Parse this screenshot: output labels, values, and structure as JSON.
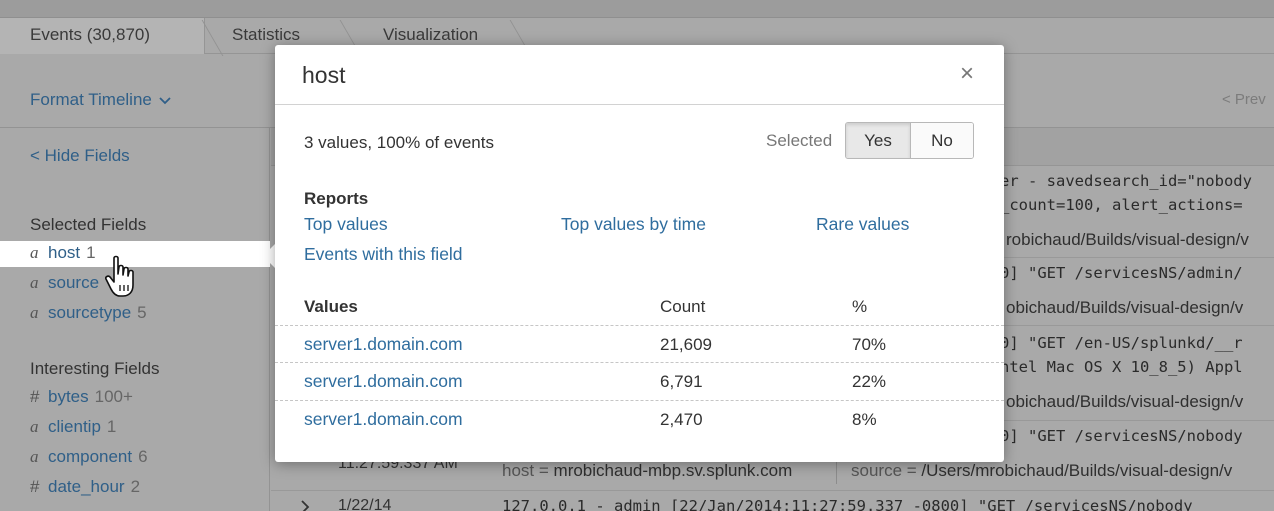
{
  "tabs": [
    {
      "label": "Events (30,870)",
      "active": true
    },
    {
      "label": "Statistics",
      "active": false
    },
    {
      "label": "Visualization",
      "active": false
    }
  ],
  "toolbar": {
    "format_timeline": "Format Timeline",
    "prev": "< Prev"
  },
  "sidebar": {
    "hide_fields": "< Hide Fields",
    "selected_title": "Selected Fields",
    "selected": [
      {
        "type": "a",
        "name": "host",
        "count": "1"
      },
      {
        "type": "a",
        "name": "source",
        "count": ""
      },
      {
        "type": "a",
        "name": "sourcetype",
        "count": "5"
      }
    ],
    "interesting_title": "Interesting Fields",
    "interesting": [
      {
        "type": "#",
        "name": "bytes",
        "count": "100+"
      },
      {
        "type": "a",
        "name": "clientip",
        "count": "1"
      },
      {
        "type": "a",
        "name": "component",
        "count": "6"
      },
      {
        "type": "#",
        "name": "date_hour",
        "count": "2"
      }
    ]
  },
  "events": {
    "lines": [
      "er - savedsearch_id=\"nobody",
      "_count=100, alert_actions=",
      "robichaud/Builds/visual-design/v",
      "0] \"GET /servicesNS/admin/",
      "obichaud/Builds/visual-design/v",
      "0] \"GET /en-US/splunkd/__r",
      "ntel Mac OS X 10_8_5) Appl",
      "obichaud/Builds/visual-design/v",
      "0] \"GET /servicesNS/nobody"
    ],
    "time_fragment": "11:27:59.337 AM",
    "host_label": "host =",
    "host_value": "mrobichaud-mbp.sv.splunk.com",
    "source_label": "source =",
    "source_value": "/Users/mrobichaud/Builds/visual-design/v",
    "next_date": "1/22/14",
    "next_line": "127.0.0.1 - admin [22/Jan/2014:11:27:59.337 -0800] \"GET /servicesNS/nobody"
  },
  "modal": {
    "title": "host",
    "close": "×",
    "summary": "3 values, 100% of events",
    "selected_label": "Selected",
    "yes": "Yes",
    "no": "No",
    "reports_title": "Reports",
    "reports": {
      "top_values": "Top values",
      "top_by_time": "Top values by time",
      "rare": "Rare values",
      "events_with": "Events with this field"
    },
    "columns": {
      "values": "Values",
      "count": "Count",
      "pct": "%"
    },
    "rows": [
      {
        "value": "server1.domain.com",
        "count": "21,609",
        "pct": "70%"
      },
      {
        "value": "server1.domain.com",
        "count": "6,791",
        "pct": "22%"
      },
      {
        "value": "server1.domain.com",
        "count": "2,470",
        "pct": "8%"
      }
    ]
  },
  "colors": {
    "link": "#2f6d9e",
    "overlay": "#a9a9a9"
  }
}
